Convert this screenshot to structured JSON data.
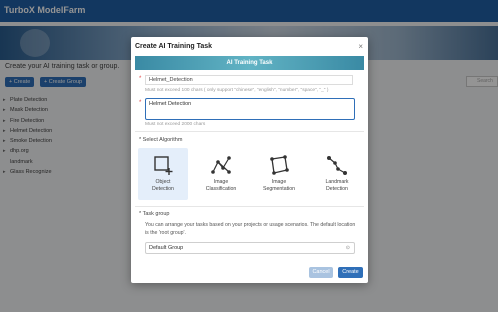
{
  "app": {
    "title": "TurboX ModelFarm"
  },
  "page": {
    "heading": "Create your AI training task or group.",
    "create_label": "+ Create",
    "create_group_label": "+ Create Group",
    "search_placeholder": "Search"
  },
  "tree": {
    "items": [
      {
        "label": "Plate Detection",
        "expandable": true
      },
      {
        "label": "Mask Detection",
        "expandable": true
      },
      {
        "label": "Fire Detection",
        "expandable": true
      },
      {
        "label": "Helmet Detection",
        "expandable": true
      },
      {
        "label": "Smoke Detection",
        "expandable": true
      },
      {
        "label": "dhp.org",
        "expandable": true
      },
      {
        "label": "landmark",
        "expandable": false
      },
      {
        "label": "Glass Recognize",
        "expandable": true
      }
    ]
  },
  "modal": {
    "title": "Create AI Training Task",
    "banner": "AI Training Task",
    "name_value": "Helmet_Detection",
    "name_hint": "Must not exceed 100 chars ( only support \"chinese\", \"english\", \"number\", \"space\", \"_\" )",
    "desc_value": "Helmet  Detection",
    "desc_hint": "Must not exceed 2000 chars",
    "algorithm_label": "* Select Algorithm",
    "algorithms": [
      {
        "line1": "Object",
        "line2": "Detection",
        "icon": "object-detection-icon",
        "selected": true
      },
      {
        "line1": "Image",
        "line2": "Classification",
        "icon": "image-classification-icon",
        "selected": false
      },
      {
        "line1": "Image",
        "line2": "Segmentation",
        "icon": "image-segmentation-icon",
        "selected": false
      },
      {
        "line1": "Landmark",
        "line2": "Detection",
        "icon": "landmark-detection-icon",
        "selected": false
      }
    ],
    "task_group_label": "* Task group",
    "task_group_desc": "You can arrange your tasks based on your projects or usage scenarios. The default location is the 'root group'.",
    "task_group_value": "Default Group",
    "cancel_label": "Cancel",
    "create_label": "Create"
  },
  "colors": {
    "primary": "#2f6fb8",
    "topbar": "#1f5fa6",
    "banner_teal": "#4fa1b6"
  }
}
